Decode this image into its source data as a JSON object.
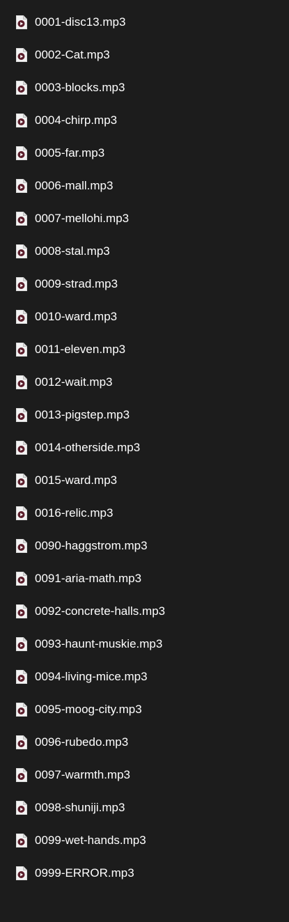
{
  "icon": "audio-file-icon",
  "colors": {
    "background": "#1c1c1c",
    "text": "#ffffff",
    "icon_page": "#f3f3f3",
    "icon_play": "#5c1f2c"
  },
  "files": [
    {
      "name": "0001-disc13.mp3"
    },
    {
      "name": "0002-Cat.mp3"
    },
    {
      "name": "0003-blocks.mp3"
    },
    {
      "name": "0004-chirp.mp3"
    },
    {
      "name": "0005-far.mp3"
    },
    {
      "name": "0006-mall.mp3"
    },
    {
      "name": "0007-mellohi.mp3"
    },
    {
      "name": "0008-stal.mp3"
    },
    {
      "name": "0009-strad.mp3"
    },
    {
      "name": "0010-ward.mp3"
    },
    {
      "name": "0011-eleven.mp3"
    },
    {
      "name": "0012-wait.mp3"
    },
    {
      "name": "0013-pigstep.mp3"
    },
    {
      "name": "0014-otherside.mp3"
    },
    {
      "name": "0015-ward.mp3"
    },
    {
      "name": "0016-relic.mp3"
    },
    {
      "name": "0090-haggstrom.mp3"
    },
    {
      "name": "0091-aria-math.mp3"
    },
    {
      "name": "0092-concrete-halls.mp3"
    },
    {
      "name": "0093-haunt-muskie.mp3"
    },
    {
      "name": "0094-living-mice.mp3"
    },
    {
      "name": "0095-moog-city.mp3"
    },
    {
      "name": "0096-rubedo.mp3"
    },
    {
      "name": "0097-warmth.mp3"
    },
    {
      "name": "0098-shuniji.mp3"
    },
    {
      "name": "0099-wet-hands.mp3"
    },
    {
      "name": "0999-ERROR.mp3"
    }
  ]
}
